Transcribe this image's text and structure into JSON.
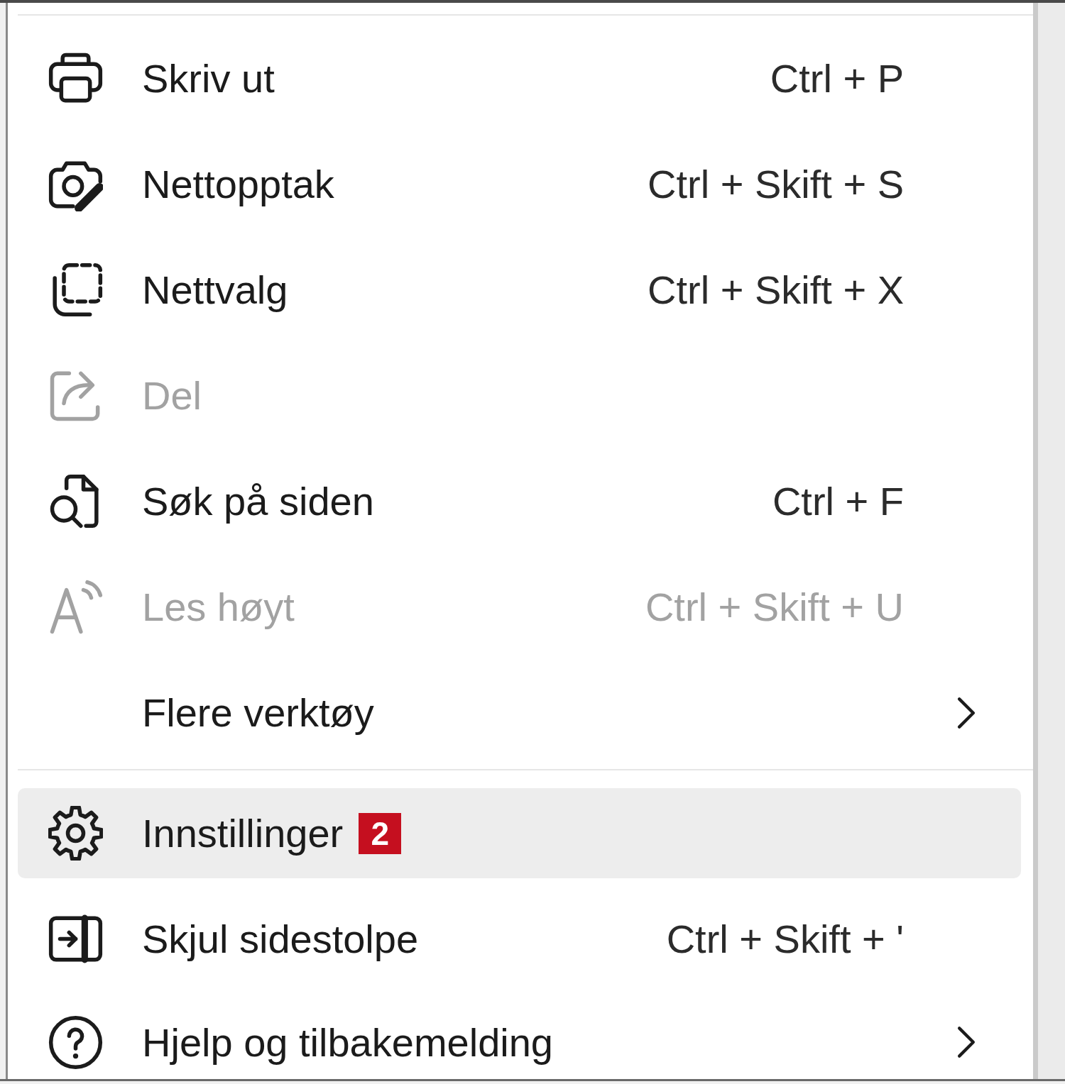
{
  "menu": {
    "items": [
      {
        "kind": "separator"
      },
      {
        "kind": "item",
        "label": "Skriv ut",
        "shortcut": "Ctrl + P",
        "disabled": false,
        "selected": false,
        "submenu": false
      },
      {
        "kind": "item",
        "label": "Nettopptak",
        "shortcut": "Ctrl + Skift + S",
        "disabled": false,
        "selected": false,
        "submenu": false
      },
      {
        "kind": "item",
        "label": "Nettvalg",
        "shortcut": "Ctrl + Skift + X",
        "disabled": false,
        "selected": false,
        "submenu": false
      },
      {
        "kind": "item",
        "label": "Del",
        "disabled": true,
        "selected": false,
        "submenu": false
      },
      {
        "kind": "item",
        "label": "Søk på siden",
        "shortcut": "Ctrl + F",
        "disabled": false,
        "selected": false,
        "submenu": false
      },
      {
        "kind": "item",
        "label": "Les høyt",
        "shortcut": "Ctrl + Skift + U",
        "disabled": true,
        "selected": false,
        "submenu": false
      },
      {
        "kind": "item",
        "label": "Flere verktøy",
        "disabled": false,
        "selected": false,
        "submenu": true
      },
      {
        "kind": "separator"
      },
      {
        "kind": "item",
        "label": "Innstillinger",
        "badge": "2",
        "disabled": false,
        "selected": true,
        "submenu": false
      },
      {
        "kind": "item",
        "label": "Skjul sidestolpe",
        "shortcut": "Ctrl + Skift + '",
        "disabled": false,
        "selected": false,
        "submenu": false
      },
      {
        "kind": "item",
        "label": "Hjelp og tilbakemelding",
        "disabled": false,
        "selected": false,
        "submenu": true
      }
    ]
  }
}
